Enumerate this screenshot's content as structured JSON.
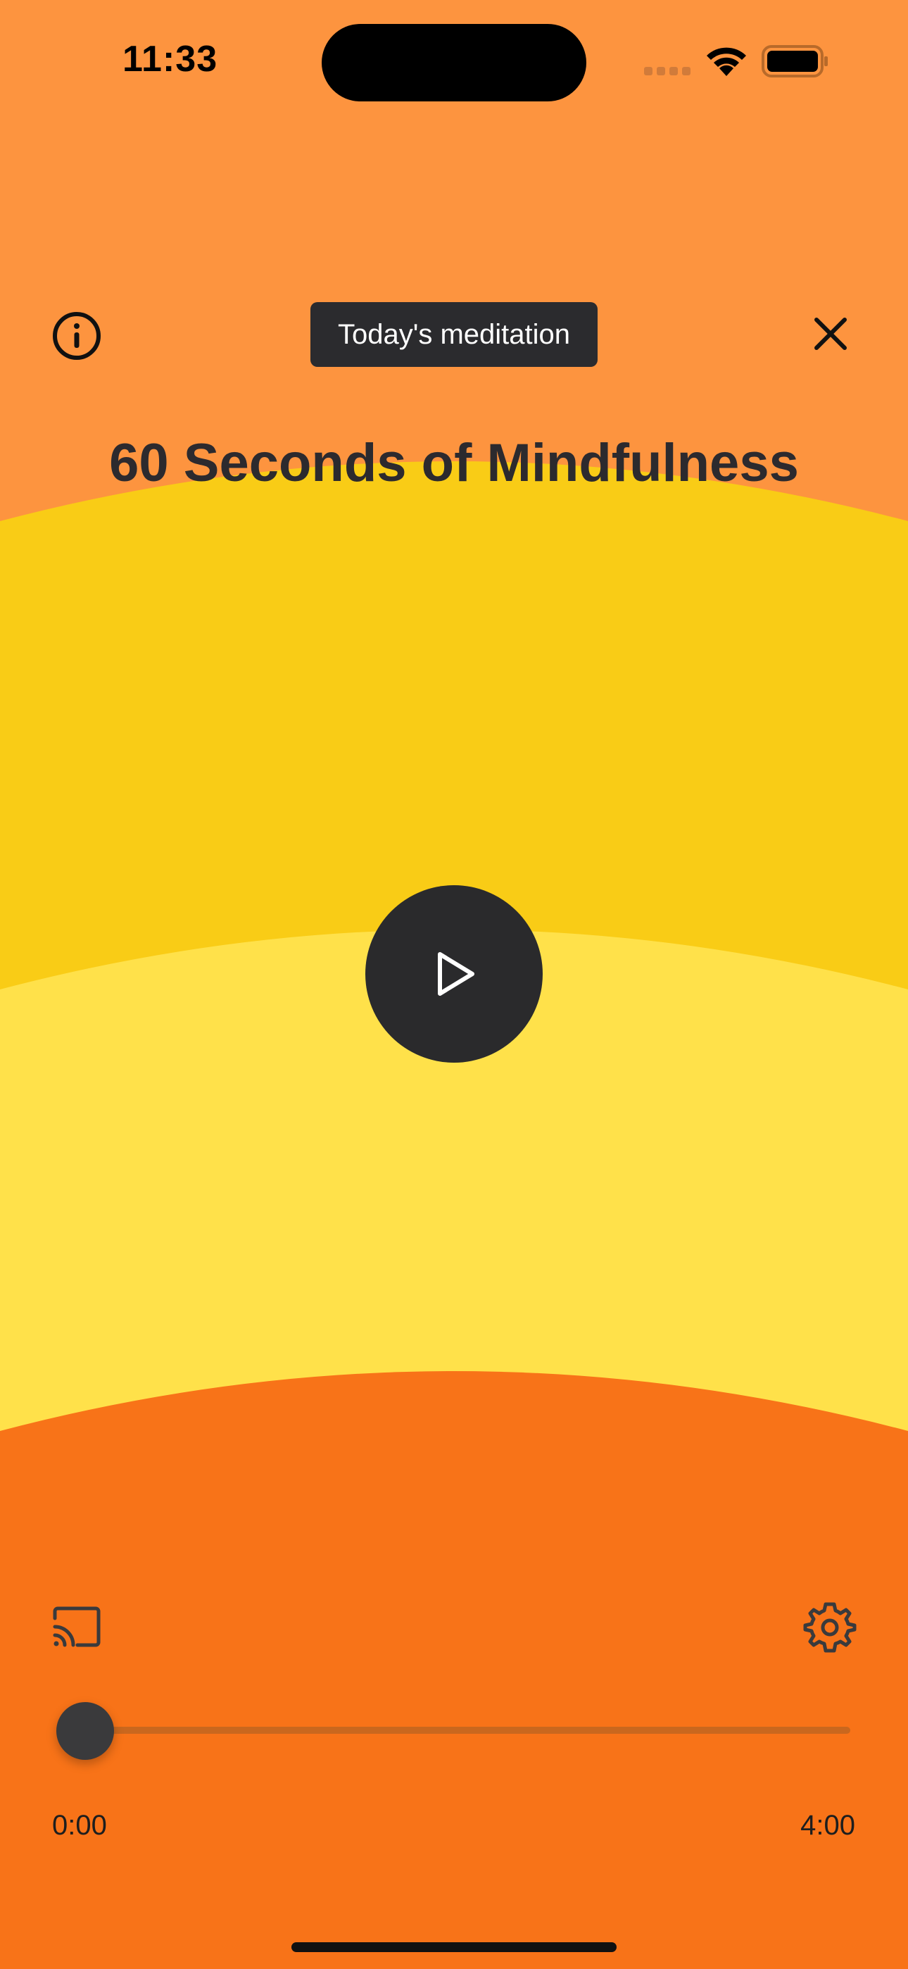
{
  "status_bar": {
    "time": "11:33"
  },
  "header": {
    "tooltip": "Today's meditation",
    "info_icon": "info-icon",
    "close_icon": "close-icon"
  },
  "meditation": {
    "title": "60 Seconds of Mindfulness"
  },
  "player": {
    "play_icon": "play-icon",
    "cast_icon": "cast-icon",
    "settings_icon": "gear-icon",
    "elapsed": "0:00",
    "duration": "4:00",
    "progress": 0
  },
  "colors": {
    "top": "#FD943F",
    "band1": "#F9CC16",
    "band2": "#FFE14A",
    "bottom": "#F87318",
    "control_dark": "#2A2A2C"
  }
}
